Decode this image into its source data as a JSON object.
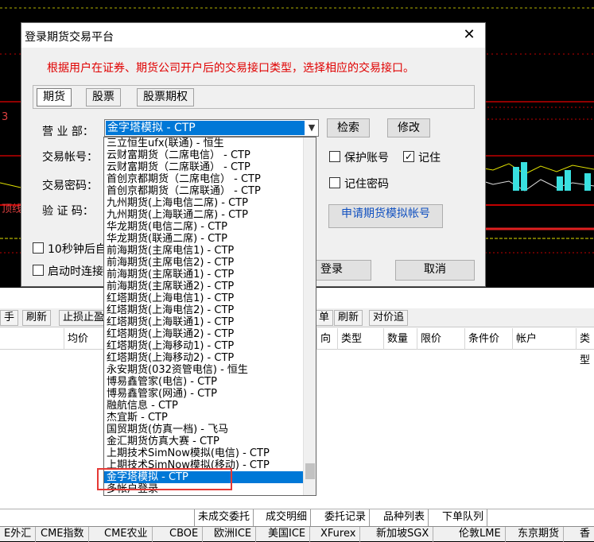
{
  "dialog": {
    "title": "登录期货交易平台",
    "close": "✕",
    "hint": "根据用户在证券、期货公司开户后的交易接口类型，选择相应的交易接口。",
    "tabs": [
      "期货",
      "股票",
      "股票期权"
    ],
    "labels": {
      "branch": "营 业 部：",
      "account": "交易帐号：",
      "password": "交易密码：",
      "verify": "验 证 码："
    },
    "branch_value": "金字塔模拟 - CTP",
    "buttons": {
      "search": "检索",
      "modify": "修改",
      "login": "登录",
      "cancel": "取消",
      "apply": "申请期货模拟帐号"
    },
    "checks": {
      "protect": "保护账号",
      "remember": "记住",
      "remember_pwd": "记住密码",
      "ten_sec": "10秒钟后自",
      "startup": "启动时连接"
    }
  },
  "dropdown": {
    "items": [
      "三立恒生ufx(联通) - 恒生",
      "云财富期货（二席电信） - CTP",
      "云财富期货（二席联通） - CTP",
      "首创京都期货（二席电信） - CTP",
      "首创京都期货（二席联通） - CTP",
      "九州期货(上海电信二席) - CTP",
      "九州期货(上海联通二席) - CTP",
      "华龙期货(电信二席) - CTP",
      "华龙期货(联通二席) - CTP",
      "前海期货(主席电信1) - CTP",
      "前海期货(主席电信2) - CTP",
      "前海期货(主席联通1) - CTP",
      "前海期货(主席联通2) - CTP",
      "红塔期货(上海电信1) - CTP",
      "红塔期货(上海电信2) - CTP",
      "红塔期货(上海联通1) - CTP",
      "红塔期货(上海联通2) - CTP",
      "红塔期货(上海移动1) - CTP",
      "红塔期货(上海移动2) - CTP",
      "永安期货(032资管电信) - 恒生",
      "博易鑫管家(电信) - CTP",
      "博易鑫管家(网通) - CTP",
      "融航信息 - CTP",
      "杰宜斯 - CTP",
      "国贸期货(仿真一档) - 飞马",
      "金汇期货仿真大赛 - CTP",
      "上期技术SimNow模拟(电信) - CTP",
      "上期技术SimNow模拟(移动) - CTP",
      "金字塔模拟 - CTP",
      "多帐户登录"
    ],
    "selected_index": 28
  },
  "background": {
    "toolbar": [
      "手",
      "刷新",
      "止损止盈",
      "单",
      "刷新",
      "对价追"
    ],
    "headers": [
      "均价",
      "向",
      "类型",
      "数量",
      "限价",
      "条件价",
      "帐户",
      "类型"
    ],
    "tabs": [
      "未成交委托",
      "成交明细",
      "委托记录",
      "品种列表",
      "下单队列"
    ],
    "exchanges": [
      "E外汇",
      "CME指数",
      "CME农业",
      "CBOE",
      "欧洲ICE",
      "美国ICE",
      "XFurex",
      "新加坡SGX",
      "伦敦LME",
      "东京期货",
      "香"
    ],
    "chart_tags": {
      "left_num": "3",
      "left_text": "顶线"
    }
  },
  "colors": {
    "selection": "#0078d7",
    "hint": "#e00000",
    "highlight": "#e53935"
  }
}
